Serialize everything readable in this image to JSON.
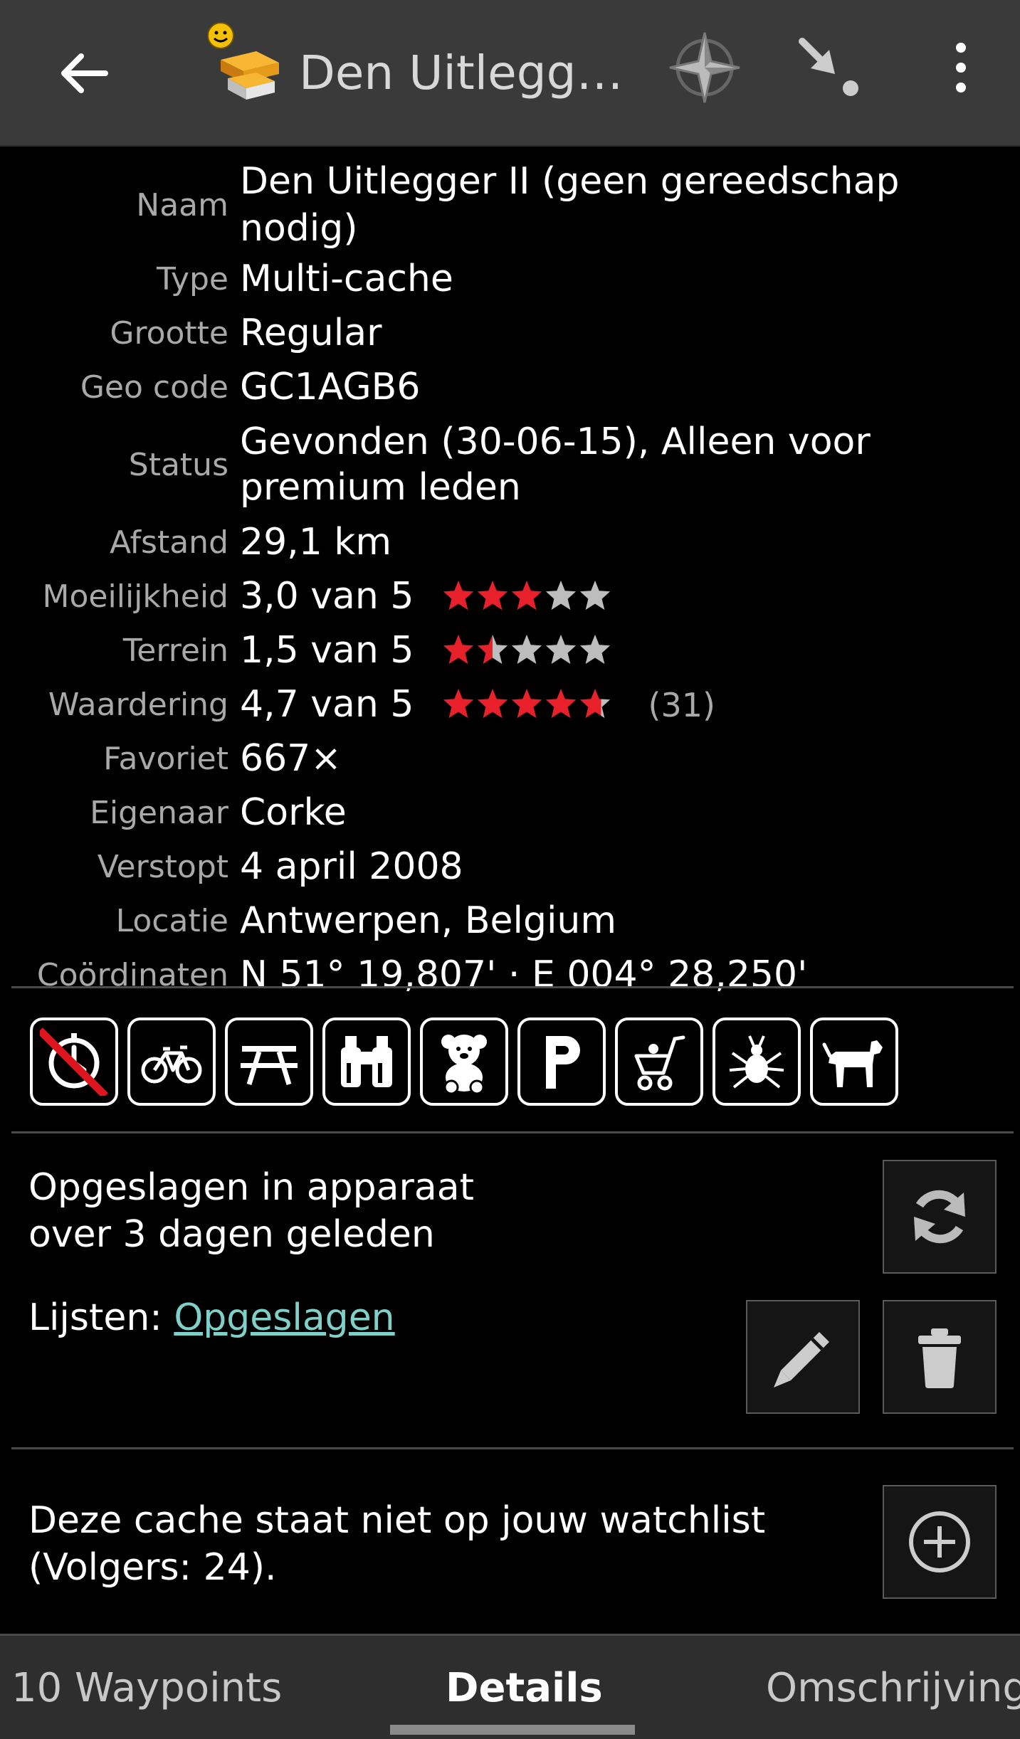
{
  "appbar": {
    "title": "Den Uitlegger...",
    "icons": [
      "back-arrow-icon",
      "multi-cache-icon",
      "compass-icon",
      "navigate-icon",
      "more-vert-icon"
    ]
  },
  "details": [
    {
      "label": "Naam",
      "value": "Den Uitlegger II (geen gereedschap nodig)"
    },
    {
      "label": "Type",
      "value": "Multi-cache"
    },
    {
      "label": "Grootte",
      "value": "Regular"
    },
    {
      "label": "Geo code",
      "value": "GC1AGB6"
    },
    {
      "label": "Status",
      "value": "Gevonden (30-06-15), Alleen voor premium leden"
    },
    {
      "label": "Afstand",
      "value": "29,1 km"
    },
    {
      "label": "Moeilijkheid",
      "value": "3,0 van 5",
      "stars": 3.0
    },
    {
      "label": "Terrein",
      "value": "1,5 van 5",
      "stars": 1.5
    },
    {
      "label": "Waardering",
      "value": "4,7 van 5",
      "stars": 4.7,
      "votes": "(31)"
    },
    {
      "label": "Favoriet",
      "value": "667×"
    },
    {
      "label": "Eigenaar",
      "value": "Corke"
    },
    {
      "label": "Verstopt",
      "value": "4 april 2008"
    },
    {
      "label": "Locatie",
      "value": "Antwerpen, Belgium"
    },
    {
      "label": "Coördinaten",
      "value": "N 51° 19,807' · E 004° 28,250'"
    }
  ],
  "attributes": [
    "no-long-walk-icon",
    "bicycle-icon",
    "picnic-table-icon",
    "binoculars-icon",
    "teddy-bear-icon",
    "parking-icon",
    "stroller-icon",
    "tick-icon",
    "dog-icon"
  ],
  "storage": {
    "line1": "Opgeslagen in apparaat",
    "line2": "over 3 dagen geleden",
    "lists_label": "Lijsten: ",
    "lists_link": "Opgeslagen"
  },
  "watchlist": {
    "line1": "Deze cache staat niet op jouw watchlist",
    "line2": "(Volgers: 24)."
  },
  "tabs": {
    "waypoints": "10 Waypoints",
    "details": "Details",
    "description": "Omschrijving"
  },
  "colors": {
    "star_on": "#e8202a",
    "star_off": "#bdbdbd",
    "link": "#7fd0c8",
    "appbar": "#3a3a3a"
  }
}
